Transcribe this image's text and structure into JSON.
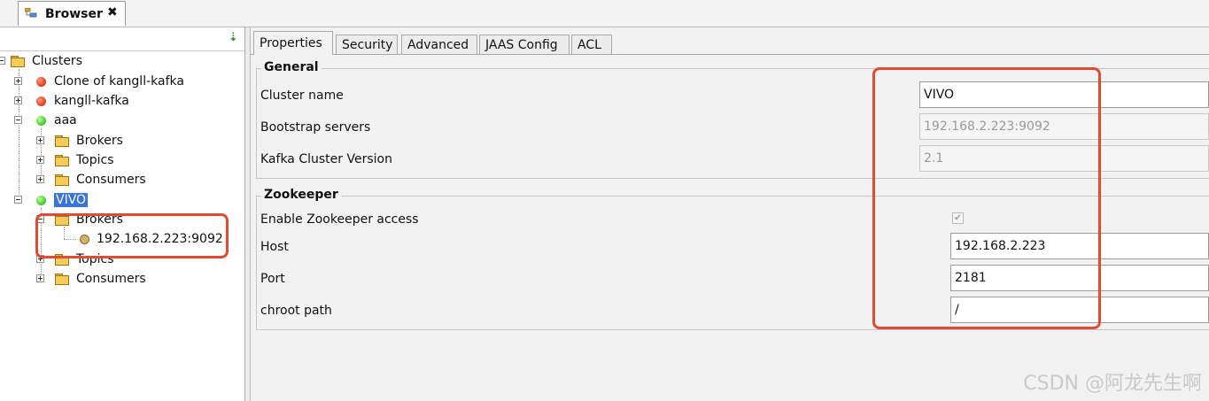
{
  "view_tab": {
    "label": "Browser",
    "close": "✖"
  },
  "tree": {
    "root": "Clusters",
    "clusters": [
      {
        "name": "Clone of kangll-kafka",
        "status_color": "#e2452a"
      },
      {
        "name": "kangll-kafka",
        "status_color": "#e2452a"
      },
      {
        "name": "aaa",
        "status_color": "#4fce36",
        "children": [
          "Brokers",
          "Topics",
          "Consumers"
        ]
      },
      {
        "name": "VIVO",
        "status_color": "#4fce36",
        "brokers_label": "Brokers",
        "broker": "192.168.2.223:9092",
        "children": [
          "Topics",
          "Consumers"
        ]
      }
    ]
  },
  "tabs": [
    "Properties",
    "Security",
    "Advanced",
    "JAAS Config",
    "ACL"
  ],
  "general": {
    "title": "General",
    "cluster_name_label": "Cluster name",
    "cluster_name_value": "VIVO",
    "bootstrap_label": "Bootstrap servers",
    "bootstrap_value": "192.168.2.223:9092",
    "version_label": "Kafka Cluster Version",
    "version_value": "2.1"
  },
  "zookeeper": {
    "title": "Zookeeper",
    "enable_label": "Enable Zookeeper access",
    "enable_checked": "✔",
    "host_label": "Host",
    "host_value": "192.168.2.223",
    "port_label": "Port",
    "port_value": "2181",
    "chroot_label": "chroot path",
    "chroot_value": "/"
  },
  "annotation_color": "#e14b36",
  "watermark": "CSDN @阿龙先生啊"
}
